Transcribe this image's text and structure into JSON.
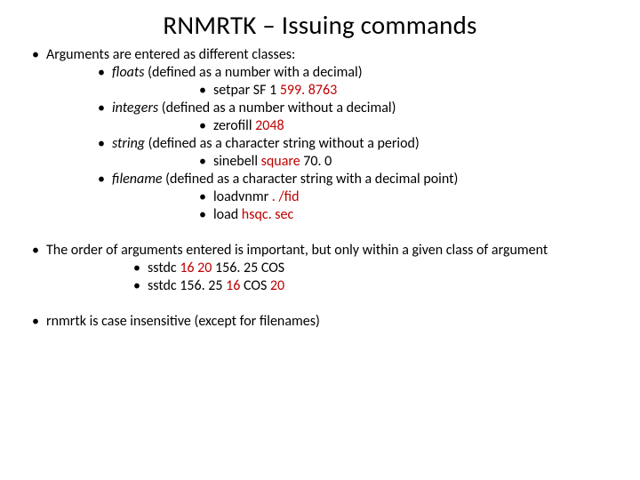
{
  "title": "RNMRTK –  Issuing commands",
  "b1": {
    "text": "Arguments are entered as different classes:",
    "floats": {
      "label": "floats",
      "def": " (defined as a number with a decimal)",
      "ex_cmd": "setpar SF 1 ",
      "ex_val": "599. 8763"
    },
    "integers": {
      "label": "integers",
      "def": " (defined as a number without a decimal)",
      "ex_cmd": "zerofill ",
      "ex_val": "2048"
    },
    "string": {
      "label": "string",
      "def": " (defined as a character string without a period)",
      "ex_cmd": "sinebell ",
      "ex_val": "square",
      "ex_tail": " 70. 0"
    },
    "filename": {
      "label": "filename",
      "def": " (defined as a character string with a decimal point)",
      "ex1_cmd": "loadvnmr ",
      "ex1_val": ". /fid",
      "ex2_cmd": "load ",
      "ex2_val": "hsqc. sec"
    }
  },
  "b2": {
    "text": "The order of arguments entered is important, but only within a given class of argument",
    "ex1_a": "sstdc ",
    "ex1_b": "16 20",
    "ex1_c": " 156. 25 COS",
    "ex2_a": "sstdc 156. 25 ",
    "ex2_b": "16",
    "ex2_c": " COS ",
    "ex2_d": "20"
  },
  "b3": {
    "text": "rnmrtk is case insensitive (except for filenames)"
  }
}
